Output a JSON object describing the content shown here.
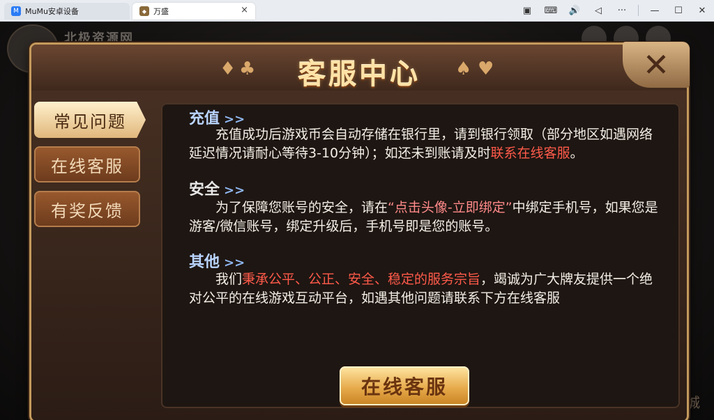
{
  "browser": {
    "tabs": [
      {
        "label": "MuMu安卓设备",
        "active": false
      },
      {
        "label": "万盛",
        "active": true
      }
    ],
    "tab_close": "×",
    "toolbar_icons": [
      "screenshot-icon",
      "keyboard-icon",
      "volume-icon",
      "back-icon",
      "more-icon",
      "minimize-icon",
      "maximize-icon",
      "close-icon"
    ],
    "toolbar_glyphs": [
      "▣",
      "⌨",
      "🔊",
      "◁",
      "···",
      "—",
      "☐",
      "✕"
    ]
  },
  "background": {
    "username": "北极资源网",
    "watermark": "城"
  },
  "dialog": {
    "title": "客服中心",
    "close_glyph": "✕",
    "suits": [
      "♦",
      "♣",
      "♠",
      "♥"
    ],
    "menu": [
      {
        "label": "常见问题",
        "active": true
      },
      {
        "label": "在线客服",
        "active": false
      },
      {
        "label": "有奖反馈",
        "active": false
      }
    ],
    "arrows": ">>",
    "sections": [
      {
        "title": "充值",
        "text_a": "充值成功后游戏币会自动存储在银行里，请到银行领取（部分地区如遇网络延迟情况请耐心等待3-10分钟）；如还未到账请及时",
        "highlight": "联系在线客服",
        "text_b": "。"
      },
      {
        "title": "安全",
        "text_a": "为了保障您账号的安全，请在",
        "highlight": "“点击头像-立即绑定”",
        "text_b": "中绑定手机号，如果您是游客/微信账号，绑定升级后，手机号即是您的账号。"
      },
      {
        "title": "其他",
        "text_a": "我们",
        "highlight": "秉承公平、公正、安全、稳定的服务宗旨",
        "text_b": "，竭诚为广大牌友提供一个绝对公平的在线游戏互动平台，如遇其他问题请联系下方在线客服"
      }
    ],
    "cta_label": "在线客服"
  },
  "colors": {
    "accent_gold": "#e7ab4c",
    "highlight_red": "#ff5a4a",
    "section_blue": "#b9d4ff"
  }
}
